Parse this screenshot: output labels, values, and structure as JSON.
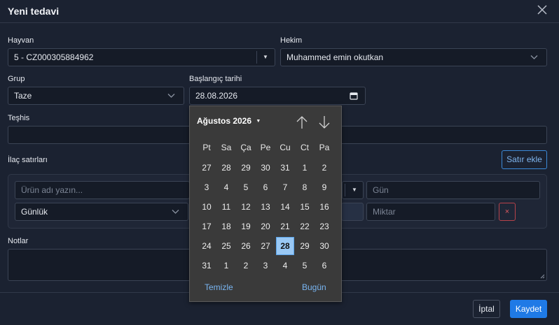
{
  "modal": {
    "title": "Yeni tedavi"
  },
  "form": {
    "animal": {
      "label": "Hayvan",
      "value": "5 - CZ000305884962"
    },
    "vet": {
      "label": "Hekim",
      "value": "Muhammed emin okutkan"
    },
    "group": {
      "label": "Grup",
      "value": "Taze"
    },
    "start_date": {
      "label": "Başlangıç tarihi",
      "value": "28.08.2026"
    },
    "diagnosis": {
      "label": "Teşhis",
      "value": ""
    },
    "drug_lines": {
      "label": "İlaç satırları",
      "add_button": "Satır ekle",
      "product_placeholder": "Ürün adı yazın...",
      "day_placeholder": "Gün",
      "frequency_value": "Günlük",
      "amount_placeholder": "Miktar",
      "remove_label": "×"
    },
    "notes": {
      "label": "Notlar",
      "value": ""
    }
  },
  "calendar": {
    "month_label": "Ağustos 2026",
    "weekdays": [
      "Pt",
      "Sa",
      "Ça",
      "Pe",
      "Cu",
      "Ct",
      "Pa"
    ],
    "weeks": [
      [
        "27",
        "28",
        "29",
        "30",
        "31",
        "1",
        "2"
      ],
      [
        "3",
        "4",
        "5",
        "6",
        "7",
        "8",
        "9"
      ],
      [
        "10",
        "11",
        "12",
        "13",
        "14",
        "15",
        "16"
      ],
      [
        "17",
        "18",
        "19",
        "20",
        "21",
        "22",
        "23"
      ],
      [
        "24",
        "25",
        "26",
        "27",
        "28",
        "29",
        "30"
      ],
      [
        "31",
        "1",
        "2",
        "3",
        "4",
        "5",
        "6"
      ]
    ],
    "selected": {
      "week": 4,
      "day": 4
    },
    "clear_label": "Temizle",
    "today_label": "Bugün"
  },
  "footer": {
    "cancel_label": "İptal",
    "save_label": "Kaydet"
  },
  "colors": {
    "accent": "#1f7ae6",
    "selected_day": "#99c8f4",
    "danger": "#d9535a"
  }
}
